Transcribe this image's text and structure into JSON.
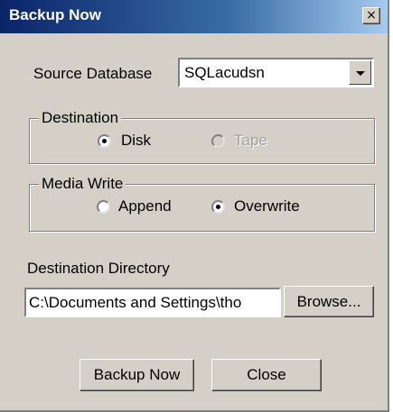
{
  "window": {
    "title": "Backup Now",
    "close_glyph": "×"
  },
  "source": {
    "label": "Source Database",
    "selected": "SQLacudsn"
  },
  "destination": {
    "legend": "Destination",
    "options": [
      {
        "label": "Disk",
        "checked": true,
        "enabled": true
      },
      {
        "label": "Tape",
        "checked": false,
        "enabled": false
      }
    ]
  },
  "media_write": {
    "legend": "Media Write",
    "options": [
      {
        "label": "Append",
        "checked": false
      },
      {
        "label": "Overwrite",
        "checked": true
      }
    ]
  },
  "directory": {
    "label": "Destination Directory",
    "value": "C:\\Documents and Settings\\tho",
    "browse_label": "Browse..."
  },
  "buttons": {
    "backup_label": "Backup Now",
    "close_label": "Close"
  },
  "colors": {
    "dialog_bg": "#d4d0c8",
    "title_start": "#0a246a",
    "title_end": "#a6caf0"
  },
  "icons": {
    "dropdown": "chevron-down-icon",
    "close": "close-icon"
  }
}
